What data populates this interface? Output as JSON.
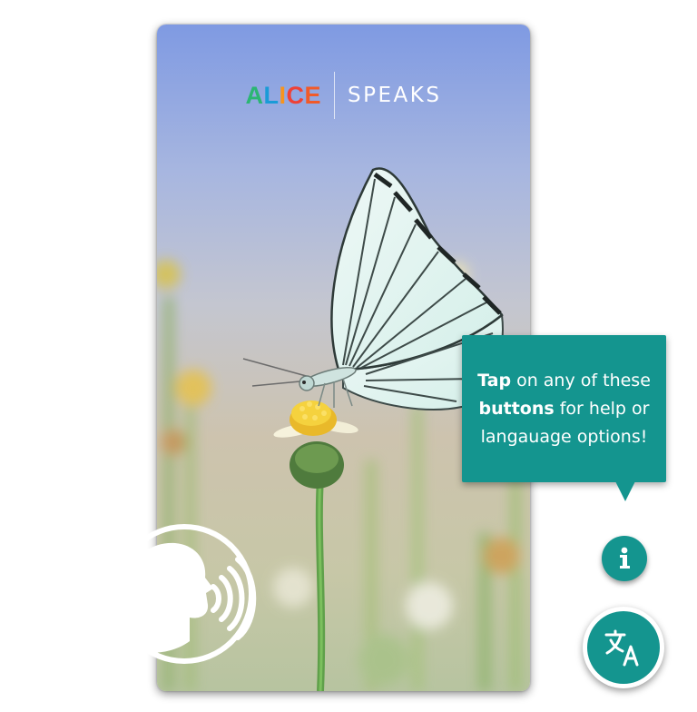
{
  "app": {
    "logo_left": [
      "A",
      "L",
      "I",
      "C",
      "E"
    ],
    "logo_colors": [
      "#2bb673",
      "#1a9bd7",
      "#f7941d",
      "#ef4136",
      "#f15a29"
    ],
    "logo_right": "SPEAKS"
  },
  "tooltip": {
    "bold_1": "Tap",
    "text_1": " on any of these ",
    "bold_2": "buttons",
    "text_2": " for help or langauage options!"
  },
  "icons": {
    "info": "info-icon",
    "translate": "translate-icon",
    "speak": "speaking-head-icon"
  },
  "colors": {
    "accent": "#14958f",
    "white": "#ffffff"
  }
}
